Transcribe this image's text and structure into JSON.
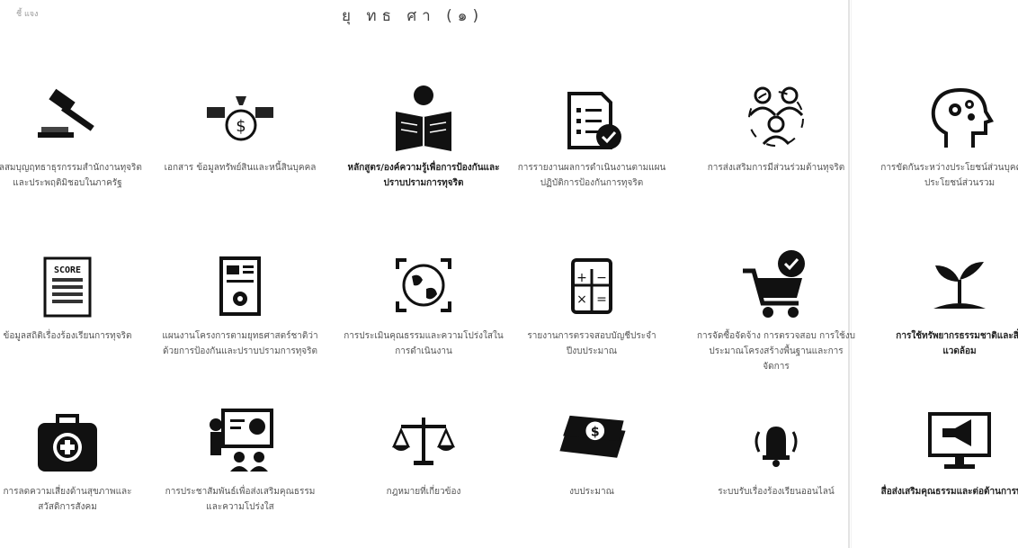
{
  "header": {
    "top_left_text": "ชี้ แจง",
    "title": "ยุ ทธ ศา (๑)"
  },
  "services": [
    {
      "icon": "gavel-icon",
      "label": "มูลสมบุญฤทธาธุรกรรมสำนักงานทุจริตและประพฤติมิชอบในภาครัฐ"
    },
    {
      "icon": "money-bag-icon",
      "label": "เอกสาร ข้อมูลทรัพย์สินและหนี้สินบุคคล"
    },
    {
      "icon": "reading-person-icon",
      "label": "หลักสูตร/องค์ความรู้เพื่อการป้องกันและปราบปรามการทุจริต"
    },
    {
      "icon": "checklist-icon",
      "label": "การรายงานผลการดำเนินงานตามแผนปฏิบัติการป้องกันการทุจริต"
    },
    {
      "icon": "people-network-icon",
      "label": "การส่งเสริมการมีส่วนร่วมต้านทุจริต"
    },
    {
      "icon": "brain-gears-icon",
      "label": "การขัดกันระหว่างประโยชน์ส่วนบุคคลกับประโยชน์ส่วนรวม"
    },
    {
      "icon": "score-board-icon",
      "label": "ข้อมูลสถิติเรื่องร้องเรียนการทุจริต"
    },
    {
      "icon": "document-gear-icon",
      "label": "แผนงานโครงการตามยุทธศาสตร์ชาติว่าด้วยการป้องกันและปราบปรามการทุจริต"
    },
    {
      "icon": "globe-scan-icon",
      "label": "การประเมินคุณธรรมและความโปร่งใสในการดำเนินงาน"
    },
    {
      "icon": "calculator-icon",
      "label": "รายงานการตรวจสอบบัญชีประจำปีงบประมาณ"
    },
    {
      "icon": "shopping-cart-icon",
      "label": "การจัดซื้อจัดจ้าง การตรวจสอบ การใช้งบประมาณโครงสร้างพื้นฐานและการจัดการ"
    },
    {
      "icon": "plant-sprout-icon",
      "label": "การใช้ทรัพยากรธรรมชาติและสิ่งแวดล้อม"
    },
    {
      "icon": "first-aid-kit-icon",
      "label": "การลดความเสี่ยงด้านสุขภาพและสวัสดิการสังคม"
    },
    {
      "icon": "presentation-icon",
      "label": "การประชาสัมพันธ์เพื่อส่งเสริมคุณธรรมและความโปร่งใส"
    },
    {
      "icon": "balance-scale-icon",
      "label": "กฎหมายที่เกี่ยวข้อง"
    },
    {
      "icon": "money-icon",
      "label": "งบประมาณ"
    },
    {
      "icon": "alarm-bell-icon",
      "label": "ระบบรับเรื่องร้องเรียนออนไลน์"
    },
    {
      "icon": "monitor-megaphone-icon",
      "label": "สื่อส่งเสริมคุณธรรมและต่อต้านการทุจริต"
    }
  ]
}
